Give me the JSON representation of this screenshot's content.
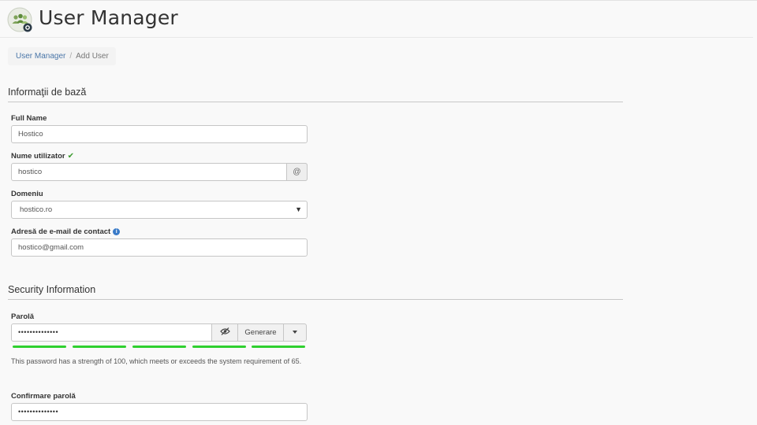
{
  "header": {
    "title": "User Manager",
    "icon": "user-manager-icon"
  },
  "breadcrumb": {
    "items": [
      "User Manager",
      "Add User"
    ]
  },
  "sections": {
    "basic": {
      "title": "Informaţii de bază"
    },
    "security": {
      "title": "Security Information"
    }
  },
  "fields": {
    "full_name": {
      "label": "Full Name",
      "value": "Hostico"
    },
    "username": {
      "label": "Nume utilizator",
      "value": "hostico",
      "addon": "@",
      "valid": true
    },
    "domain": {
      "label": "Domeniu",
      "value": "hostico.ro"
    },
    "email": {
      "label": "Adresă de e-mail de contact",
      "value": "hostico@gmail.com"
    },
    "password": {
      "label": "Parolă",
      "value": "••••••••••••••",
      "generate_label": "Generare",
      "strength": 100,
      "strength_text": "This password has a strength of 100, which meets or exceeds the system requirement of 65."
    },
    "confirm_password": {
      "label": "Confirmare parolă",
      "value": "••••••••••••••"
    }
  },
  "colors": {
    "strength_bar": "#2fd02f",
    "link": "#4a76a8",
    "check": "#3c9a2f"
  }
}
